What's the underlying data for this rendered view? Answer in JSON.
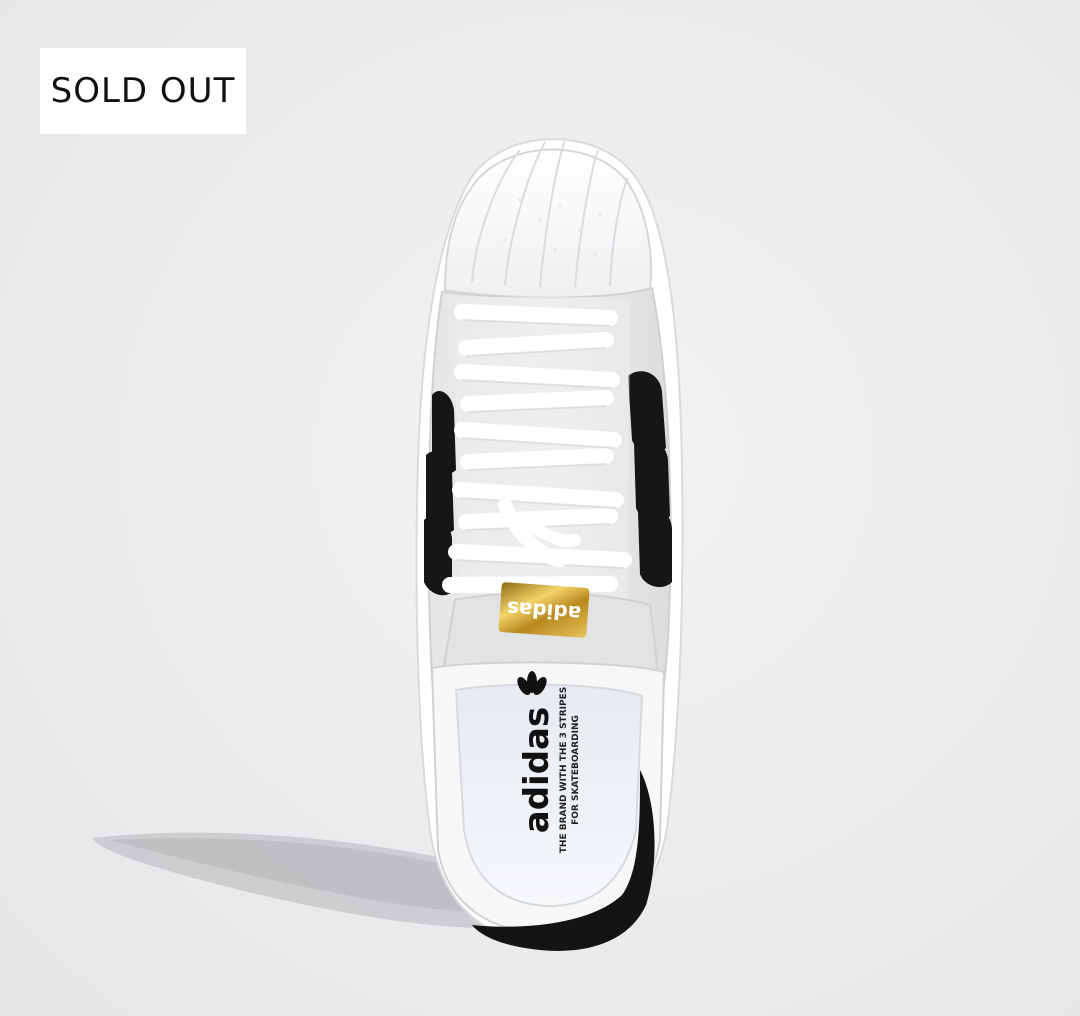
{
  "badge": {
    "label": "SOLD OUT"
  },
  "product": {
    "image_icon": "sneaker-top-view-icon",
    "insole_brand": "adidas",
    "insole_tagline_line1": "THE BRAND WITH THE 3 STRIPES",
    "insole_tagline_line2": "FOR SKATEBOARDING",
    "tongue_label": "adidas"
  },
  "colors": {
    "background": "#ebedef",
    "badge_bg": "#ffffff",
    "badge_text": "#111111",
    "stripe": "#111111",
    "gold": "#c9a227"
  }
}
